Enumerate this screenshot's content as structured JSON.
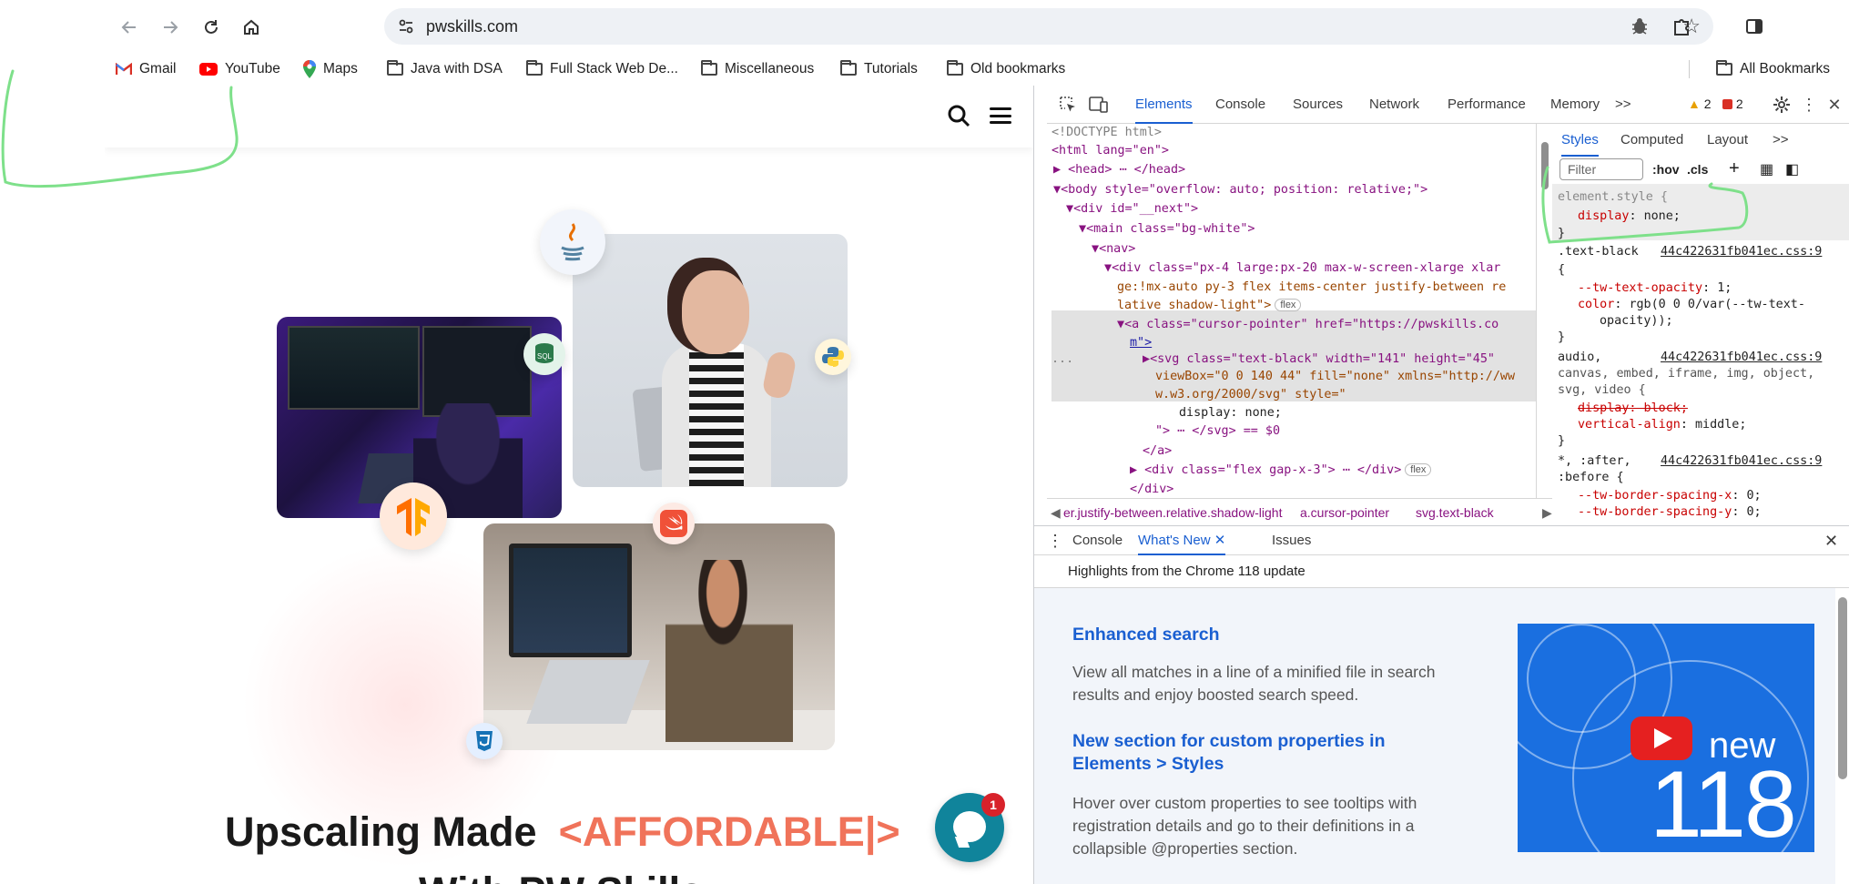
{
  "browser": {
    "url": "pwskills.com",
    "bookmarks": [
      {
        "label": "Gmail",
        "icon": "gmail-icon"
      },
      {
        "label": "YouTube",
        "icon": "youtube-icon"
      },
      {
        "label": "Maps",
        "icon": "maps-icon"
      },
      {
        "label": "Java with DSA",
        "icon": "folder-icon"
      },
      {
        "label": "Full Stack Web De...",
        "icon": "folder-icon"
      },
      {
        "label": "Miscellaneous",
        "icon": "folder-icon"
      },
      {
        "label": "Tutorials",
        "icon": "folder-icon"
      },
      {
        "label": "Old bookmarks",
        "icon": "folder-icon"
      }
    ],
    "all_bookmarks": "All Bookmarks"
  },
  "page": {
    "hero_title": "Upscaling Made",
    "hero_accent": "<AFFORDABLE|>",
    "hero_subtitle": "With PW Skills",
    "chat_count": "1",
    "badges": {
      "sql": "SQL"
    }
  },
  "devtools": {
    "tabs": [
      "Elements",
      "Console",
      "Sources",
      "Network",
      "Performance",
      "Memory",
      ">>"
    ],
    "active_tab": "Elements",
    "warnings": "2",
    "errors": "2",
    "dom": [
      {
        "text": "<!DOCTYPE html>"
      },
      {
        "text": "<html lang=\"en\">"
      },
      {
        "text": "<head> ⋯ </head>"
      },
      {
        "text": "<body style=\"overflow: auto; position: relative;\">"
      },
      {
        "text": "<div id=\"__next\">"
      },
      {
        "text": "<main class=\"bg-white\">"
      },
      {
        "text": "<nav>"
      },
      {
        "text": "<div class=\"px-4 large:px-20 max-w-screen-xlarge xlar"
      },
      {
        "text": "ge:!mx-auto py-3 flex items-center justify-between re"
      },
      {
        "text": "lative shadow-light\">"
      },
      {
        "text": "<a class=\"cursor-pointer\" href=\"https://pwskills.co"
      },
      {
        "text": "m\">"
      },
      {
        "text": "<svg class=\"text-black\" width=\"141\" height=\"45\""
      },
      {
        "text": "viewBox=\"0 0 140 44\" fill=\"none\" xmlns=\"http://ww"
      },
      {
        "text": "w.w3.org/2000/svg\" style=\""
      },
      {
        "text": "display: none;"
      },
      {
        "text": "\"> ⋯ </svg> == $0"
      },
      {
        "text": "</a>"
      },
      {
        "text": "<div class=\"flex gap-x-3\"> ⋯ </div>"
      },
      {
        "text": "</div>"
      }
    ],
    "flex_badge": "flex",
    "dots": "...",
    "breadcrumbs": [
      "er.justify-between.relative.shadow-light",
      "a.cursor-pointer",
      "svg.text-black"
    ],
    "styles_tabs": [
      "Styles",
      "Computed",
      "Layout",
      ">>"
    ],
    "filter_placeholder": "Filter",
    "hov": ":hov",
    "cls": ".cls",
    "rules": {
      "element_style": "element.style {",
      "element_prop": "display",
      "element_val": "none;",
      "close": "}",
      "r1_sel": ".text-black",
      "r1_src": "44c422631fb041ec.css:9",
      "r1_open": "{",
      "r1_p1": "--tw-text-opacity",
      "r1_v1": "1;",
      "r1_p2": "color",
      "r1_v2": "rgb(0 0 0/var(--tw-text-",
      "r1_v2b": "opacity));",
      "r2_sel1": "audio,",
      "r2_src": "44c422631fb041ec.css:9",
      "r2_sel2": "canvas, embed, iframe, img, object,",
      "r2_sel3": "svg, video {",
      "r2_p1": "display: block;",
      "r2_p2": "vertical-align",
      "r2_v2": "middle;",
      "r3_sel1": "*, :after,",
      "r3_src": "44c422631fb041ec.css:9",
      "r3_sel2": ":before {",
      "r3_p1": "--tw-border-spacing-x",
      "r3_v1": "0;",
      "r3_p2": "--tw-border-spacing-y",
      "r3_v2": "0;"
    },
    "drawer": {
      "tabs": [
        "Console",
        "What's New",
        "Issues"
      ],
      "active": "What's New",
      "highlights": "Highlights from the Chrome 118 update",
      "items": [
        {
          "title": "Enhanced search",
          "body": "View all matches in a line of a minified file in search results and enjoy boosted search speed."
        },
        {
          "title": "New section for custom properties in Elements > Styles",
          "body": "Hover over custom properties to see tooltips with registration details and go to their definitions in a collapsible @properties section."
        }
      ],
      "image_new": "new",
      "image_version": "118"
    }
  },
  "colors": {
    "accent": "#1a5fd1",
    "hero_accent": "#f0735a",
    "annotation": "#7ee08a"
  }
}
